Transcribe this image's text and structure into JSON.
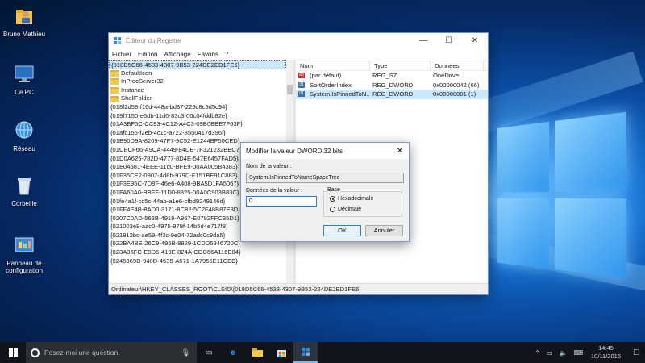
{
  "desktop": {
    "icons": [
      {
        "name": "user-folder",
        "label": "Bruno Mathieu"
      },
      {
        "name": "this-pc",
        "label": "Ce PC"
      },
      {
        "name": "network",
        "label": "Réseau"
      },
      {
        "name": "recycle-bin",
        "label": "Corbeille"
      },
      {
        "name": "control-panel",
        "label": "Panneau de configuration"
      }
    ]
  },
  "regedit": {
    "title": "Éditeur du Registre",
    "menu": [
      "Fichier",
      "Edition",
      "Affichage",
      "Favoris",
      "?"
    ],
    "tree": {
      "selected_key": "{018D5C66-4533-4307-9B53-224DE2ED1FE6}",
      "subkeys": [
        "DefaultIcon",
        "InProcServer32",
        "Instance",
        "ShellFolder"
      ],
      "siblings": [
        "{018f2d58-f16d-448a-bd87-225c8c5d5c94}",
        "{019f7150-e6db-11d0-83c3-00c04fddb82e}",
        "{01A3BF5C-CC93-4C12-A4C3-09B0BBE7F63F}",
        "{01afc156-f2eb-4c1c-a722-8550417d396f}",
        "{01B90D9A-8209-47F7-9C52-E1244BF50CED}",
        "{01CBCF66-A9CA-4449-84DE-7F321232BBC7}",
        "{01D0A625-782D-4777-8D4E-547E6457FAD5}",
        "{01E04581-4EEE-11d0-BFE9-00AA005B4383}",
        "{01F36CE2-0907-4d8b-979D-F151BE91C883}",
        "{01F3E95C-7D8F-46e6-A408-9BA5D1FA5067}",
        "{01FA60A0-BBFF-11D0-8825-00A0C903B83C}",
        "{01fe4a1f-cc5c-44ab-a1e6-cfbd9249146d}",
        "{01FF4E4B-8AD0-3171-8C82-5C2F48B87E3D}",
        "{0207C0AD-563B-4919-A967-E0782FFC35D1}",
        "{021003e9-aac0-4975-979f-14b5d4e717f8}",
        "{021812bc-ae59-4f3c-9e04-72adc0c9da5}",
        "{022BA4BE-26C9-495B-8829-1CDD5946720C}",
        "{023A36FC-E9D5-419E-824A-CDC66A116E84}",
        "{0245869D-940D-4535-A571-1A7955E11CEB}"
      ]
    },
    "columns": [
      "Nom",
      "Type",
      "Données"
    ],
    "values": [
      {
        "name": "(par défaut)",
        "type": "REG_SZ",
        "data": "OneDrive",
        "icon": "string-value-icon"
      },
      {
        "name": "SortOrderIndex",
        "type": "REG_DWORD",
        "data": "0x00000042 (66)",
        "icon": "binary-value-icon"
      },
      {
        "name": "System.IsPinnedToN...",
        "type": "REG_DWORD",
        "data": "0x00000001 (1)",
        "icon": "binary-value-icon"
      }
    ],
    "status_path": "Ordinateur\\HKEY_CLASSES_ROOT\\CLSID\\{018D5C66-4533-4307-9B53-224DE2ED1FE6}"
  },
  "dialog": {
    "title": "Modifier la valeur DWORD 32 bits",
    "name_label": "Nom de la valeur :",
    "name_value": "System.IsPinnedToNameSpaceTree",
    "data_label": "Données de la valeur :",
    "data_value": "0",
    "base_label": "Base",
    "radio_hex": "Hexadécimale",
    "radio_dec": "Décimale",
    "ok": "OK",
    "cancel": "Annuler"
  },
  "taskbar": {
    "search_placeholder": "Posez-moi une question.",
    "time": "14:45",
    "date": "10/11/2015"
  }
}
